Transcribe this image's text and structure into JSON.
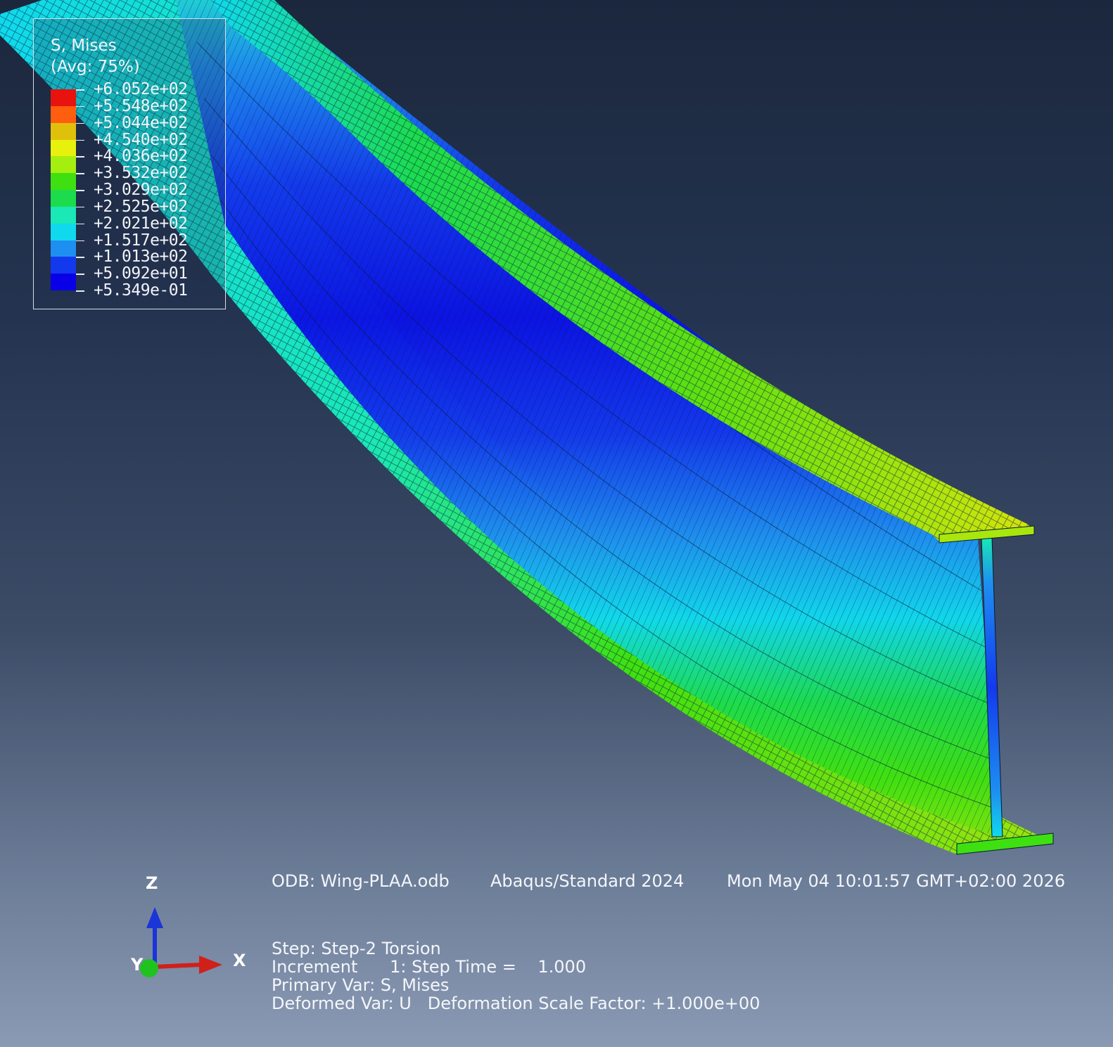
{
  "legend": {
    "title_line1": "S, Mises",
    "title_line2": "(Avg: 75%)",
    "values": [
      "+6.052e+02",
      "+5.548e+02",
      "+5.044e+02",
      "+4.540e+02",
      "+4.036e+02",
      "+3.532e+02",
      "+3.029e+02",
      "+2.525e+02",
      "+2.021e+02",
      "+1.517e+02",
      "+1.013e+02",
      "+5.092e+01",
      "+5.349e-01"
    ],
    "colors": [
      "#e8120e",
      "#ff5e0f",
      "#dfc10c",
      "#e8f00e",
      "#a4ef0f",
      "#3fe011",
      "#1cdc4d",
      "#1ae8b6",
      "#10d9ed",
      "#1e8ff0",
      "#1339ee",
      "#0a00e8"
    ]
  },
  "info": {
    "odb": "ODB: Wing-PLAA.odb",
    "solver": "Abaqus/Standard 2024",
    "date": "Mon May 04 10:01:57 GMT+02:00 2026",
    "step": "Step: Step-2 Torsion",
    "increment": "Increment      1: Step Time =    1.000",
    "primary_var": "Primary Var: S, Mises",
    "deformed_var": "Deformed Var: U   Deformation Scale Factor: +1.000e+00"
  },
  "triad": {
    "z_label": "Z",
    "y_label": "Y",
    "x_label": "X"
  },
  "colors": {
    "x_axis": "#d0201a",
    "y_axis": "#1fc21f",
    "z_axis": "#1a35d8"
  }
}
